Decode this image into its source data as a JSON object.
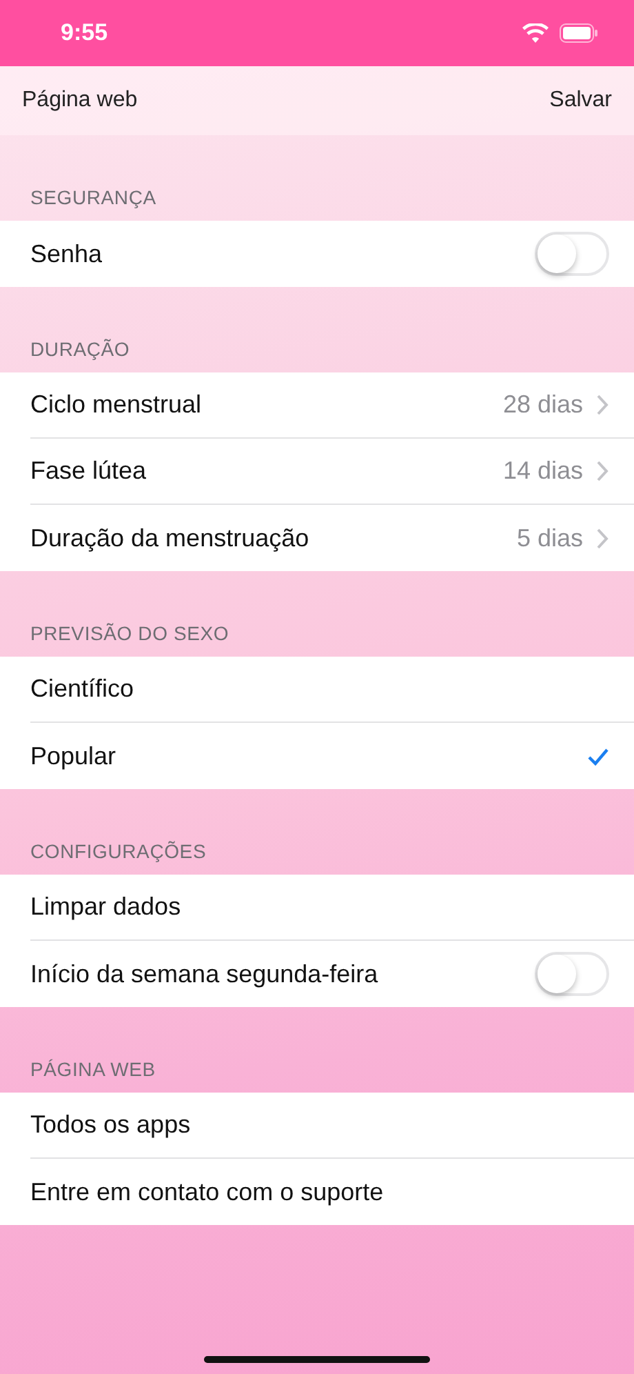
{
  "status_bar": {
    "time": "9:55"
  },
  "nav": {
    "left": "Página web",
    "right": "Salvar"
  },
  "sections": [
    {
      "title": "SEGURANÇA",
      "rows": [
        {
          "kind": "toggle",
          "label": "Senha",
          "on": false
        }
      ]
    },
    {
      "title": "DURAÇÃO",
      "rows": [
        {
          "kind": "value",
          "label": "Ciclo menstrual",
          "value": "28 dias"
        },
        {
          "kind": "value",
          "label": "Fase lútea",
          "value": "14 dias"
        },
        {
          "kind": "value",
          "label": "Duração da menstruação",
          "value": "5 dias"
        }
      ]
    },
    {
      "title": "PREVISÃO DO SEXO",
      "rows": [
        {
          "kind": "choice",
          "label": "Científico",
          "selected": false
        },
        {
          "kind": "choice",
          "label": "Popular",
          "selected": true
        }
      ]
    },
    {
      "title": "CONFIGURAÇÕES",
      "rows": [
        {
          "kind": "plain",
          "label": "Limpar dados"
        },
        {
          "kind": "toggle",
          "label": "Início da semana segunda-feira",
          "on": false
        }
      ]
    },
    {
      "title": "PÁGINA WEB",
      "rows": [
        {
          "kind": "plain",
          "label": "Todos os apps"
        },
        {
          "kind": "plain",
          "label": "Entre em contato com o suporte"
        }
      ]
    }
  ]
}
